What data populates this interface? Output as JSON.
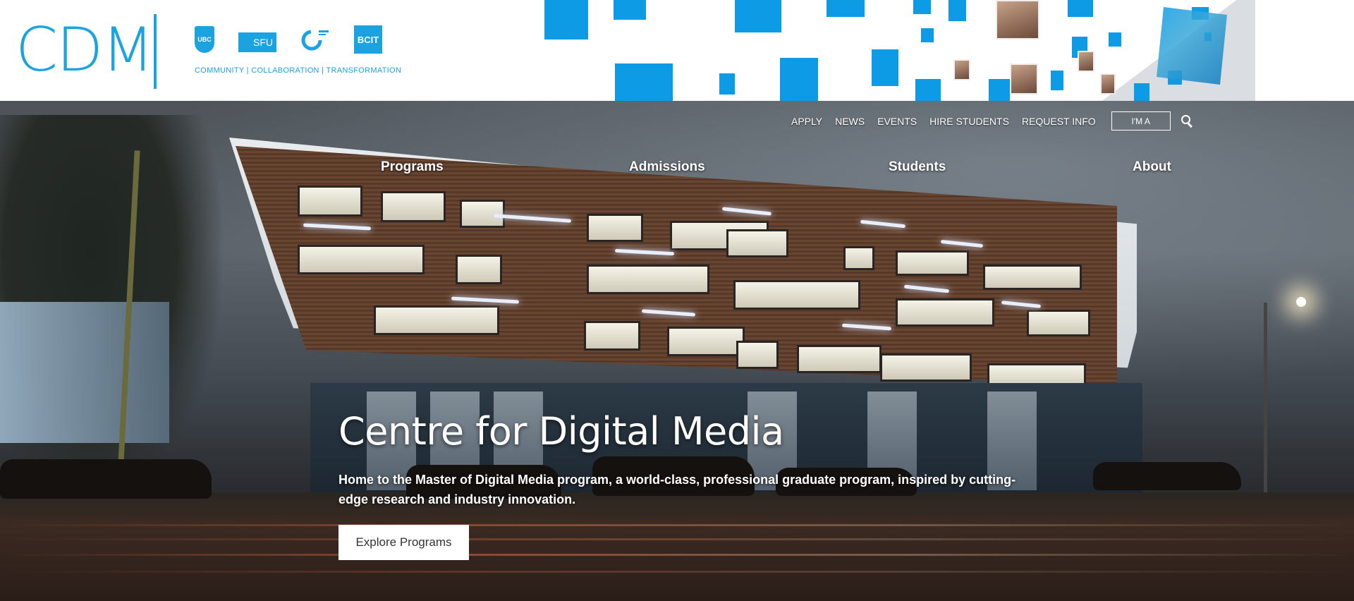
{
  "header": {
    "logo": "CDM",
    "partners": [
      "UBC",
      "SFU",
      "",
      "BCIT"
    ],
    "tagline": "COMMUNITY | COLLABORATION | TRANSFORMATION"
  },
  "utility_nav": {
    "items": [
      "APPLY",
      "NEWS",
      "EVENTS",
      "HIRE STUDENTS",
      "REQUEST INFO"
    ],
    "ima_label": "I'M A"
  },
  "main_nav": {
    "items": [
      "Programs",
      "Admissions",
      "Students",
      "About"
    ]
  },
  "hero": {
    "title": "Centre for Digital Media",
    "subtitle": "Home to the Master of Digital Media program, a world-class, professional graduate program, inspired by cutting-edge research and industry innovation.",
    "cta_label": "Explore Programs"
  },
  "colors": {
    "brand_blue": "#1aa3e0",
    "mosaic_blue": "#0d9be6"
  },
  "icons": {
    "search": "search-icon"
  }
}
